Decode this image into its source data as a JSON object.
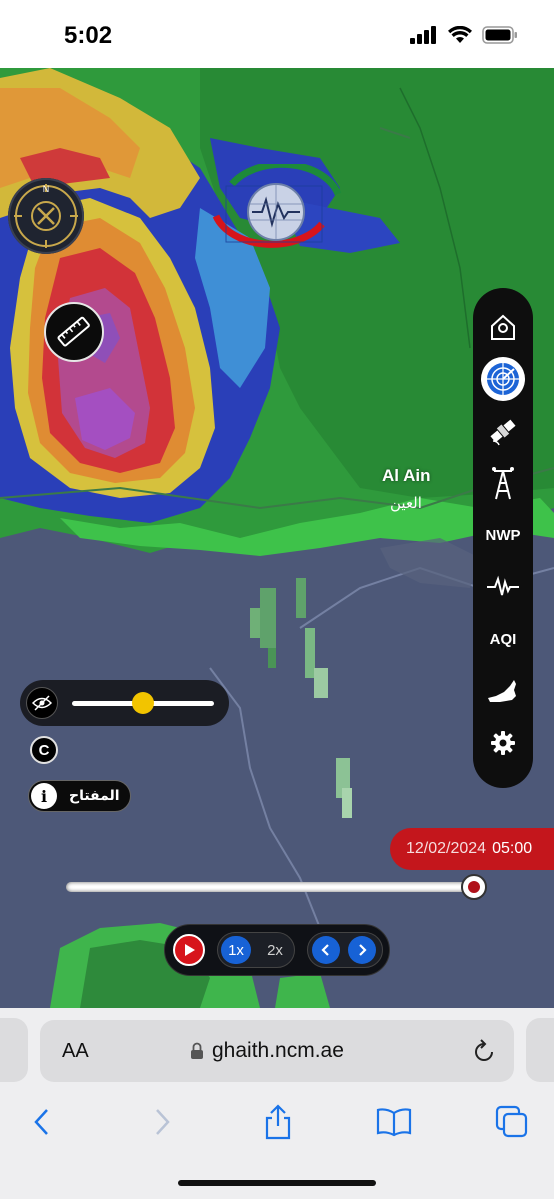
{
  "status_bar": {
    "time": "5:02"
  },
  "map": {
    "city_name_en": "Al Ain",
    "city_name_ar": "العين",
    "compass_letter": "N"
  },
  "toolbar": {
    "items": [
      {
        "name": "home",
        "label": "",
        "icon": "home-icon"
      },
      {
        "name": "radar",
        "label": "",
        "icon": "radar-icon",
        "active": true
      },
      {
        "name": "satellite",
        "label": "",
        "icon": "satellite-icon"
      },
      {
        "name": "station",
        "label": "",
        "icon": "weather-station-icon"
      },
      {
        "name": "nwp",
        "label": "NWP"
      },
      {
        "name": "seismic",
        "label": "",
        "icon": "seismic-wave-icon"
      },
      {
        "name": "aqi",
        "label": "AQI"
      },
      {
        "name": "uae-map",
        "label": "",
        "icon": "uae-map-icon"
      },
      {
        "name": "settings",
        "label": "",
        "icon": "gear-icon"
      }
    ]
  },
  "layer_controls": {
    "opacity_level": 0.5,
    "c_label": "C",
    "key_label": "المفتاح",
    "info_label": "i"
  },
  "timeline": {
    "date": "12/02/2024",
    "time": "05:00",
    "position": 1.0
  },
  "playback": {
    "speed_1x": "1x",
    "speed_2x": "2x",
    "active_speed": "1x"
  },
  "browser": {
    "text_size_label": "AA",
    "url": "ghaith.ncm.ae"
  }
}
